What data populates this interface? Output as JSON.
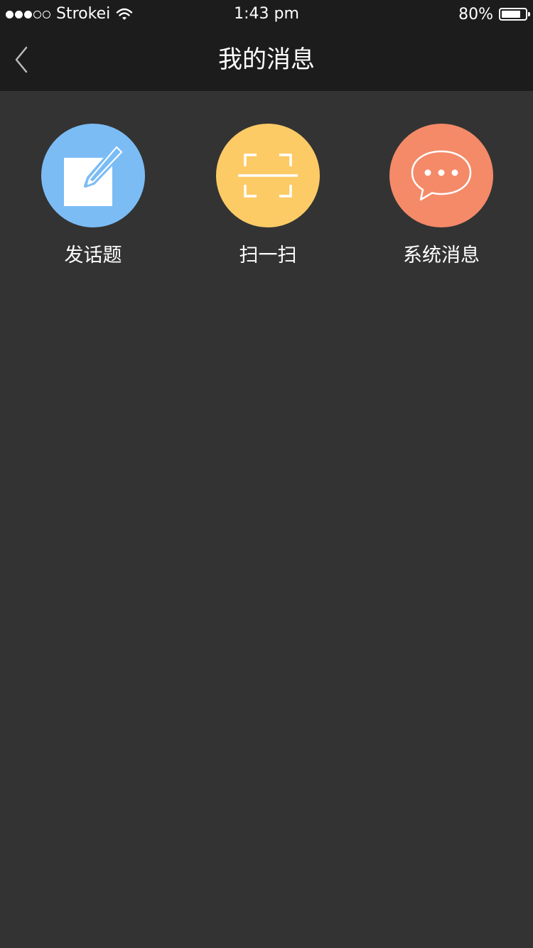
{
  "status_bar": {
    "carrier": "Strokei",
    "time": "1:43 pm",
    "battery_text": "80%",
    "battery_level": 0.8,
    "signal_bars_filled": 3,
    "signal_bars_total": 5
  },
  "nav": {
    "title": "我的消息",
    "back_icon": "chevron-left-icon"
  },
  "actions": [
    {
      "label": "发话题",
      "icon": "compose-icon",
      "color": "#7bbcf5"
    },
    {
      "label": "扫一扫",
      "icon": "scan-icon",
      "color": "#fccb66"
    },
    {
      "label": "系统消息",
      "icon": "chat-bubble-icon",
      "color": "#f48a68"
    }
  ],
  "colors": {
    "top_bar": "#1c1c1c",
    "background": "#333333",
    "text": "#ffffff"
  }
}
